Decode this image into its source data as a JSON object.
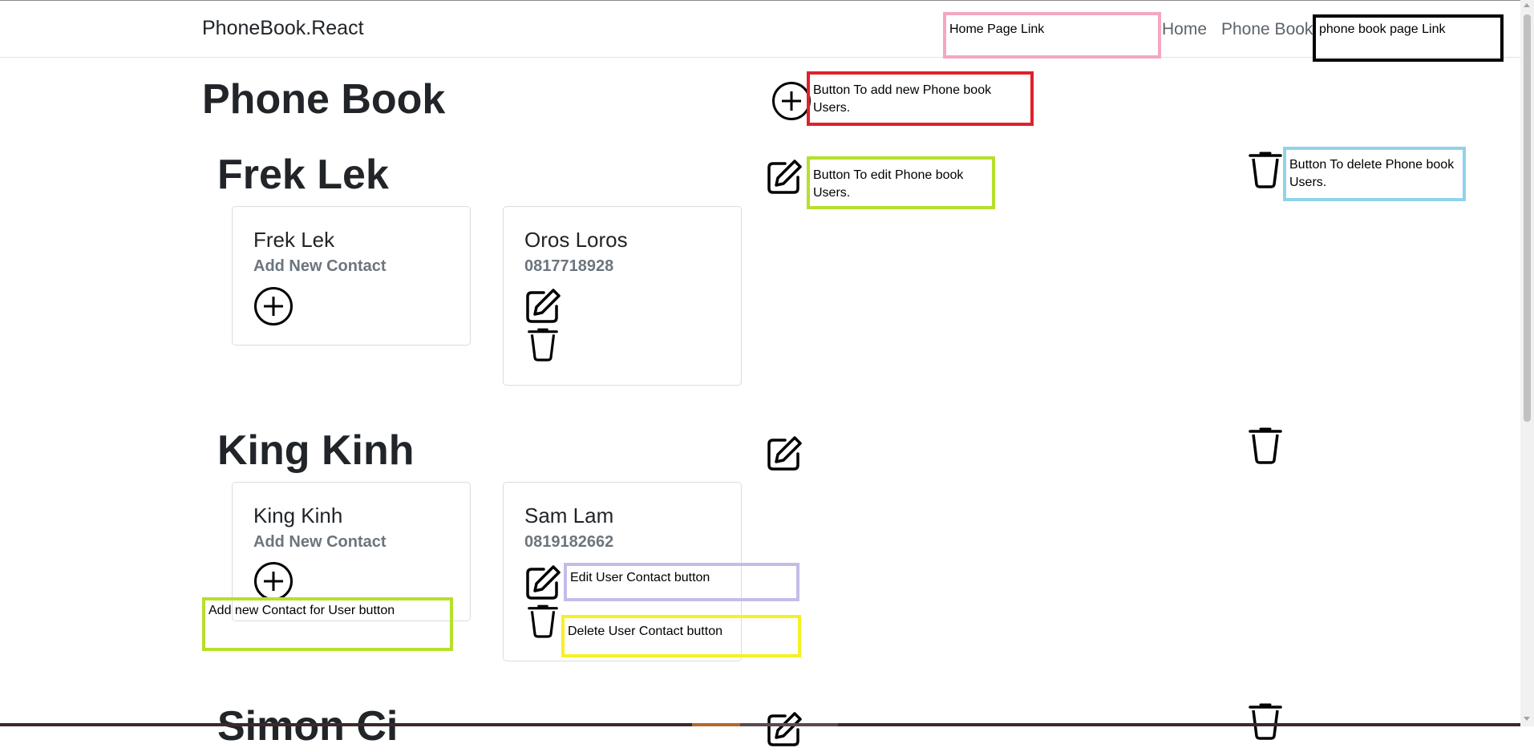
{
  "navbar": {
    "brand": "PhoneBook.React",
    "links": [
      {
        "label": "Home"
      },
      {
        "label": "Phone Book"
      }
    ]
  },
  "page": {
    "title": "Phone Book"
  },
  "users": [
    {
      "name": "Frek Lek",
      "new_contact_card": {
        "name": "Frek Lek",
        "label": "Add New Contact"
      },
      "contacts": [
        {
          "name": "Oros Loros",
          "phone": "0817718928"
        }
      ]
    },
    {
      "name": "King Kinh",
      "new_contact_card": {
        "name": "King Kinh",
        "label": "Add New Contact"
      },
      "contacts": [
        {
          "name": "Sam Lam",
          "phone": "0819182662"
        }
      ]
    },
    {
      "name": "Simon Ci"
    }
  ],
  "annotations": [
    {
      "text": "Home Page Link",
      "color": "#f4a7c1"
    },
    {
      "text": "phone book page Link",
      "color": "#000000"
    },
    {
      "text": "Button To add new Phone book Users.",
      "color": "#e0202c"
    },
    {
      "text": "Button To edit Phone book Users.",
      "color": "#b5e02a"
    },
    {
      "text": "Button To delete Phone book Users.",
      "color": "#8fd3ea"
    },
    {
      "text": "Edit User Contact button",
      "color": "#c2bde8"
    },
    {
      "text": "Delete User Contact button",
      "color": "#f7f025"
    },
    {
      "text": "Add new Contact for User button",
      "color": "#b5e02a"
    }
  ],
  "icons": {
    "add": "plus-circle-icon",
    "edit": "edit-icon",
    "delete": "trash-icon"
  }
}
